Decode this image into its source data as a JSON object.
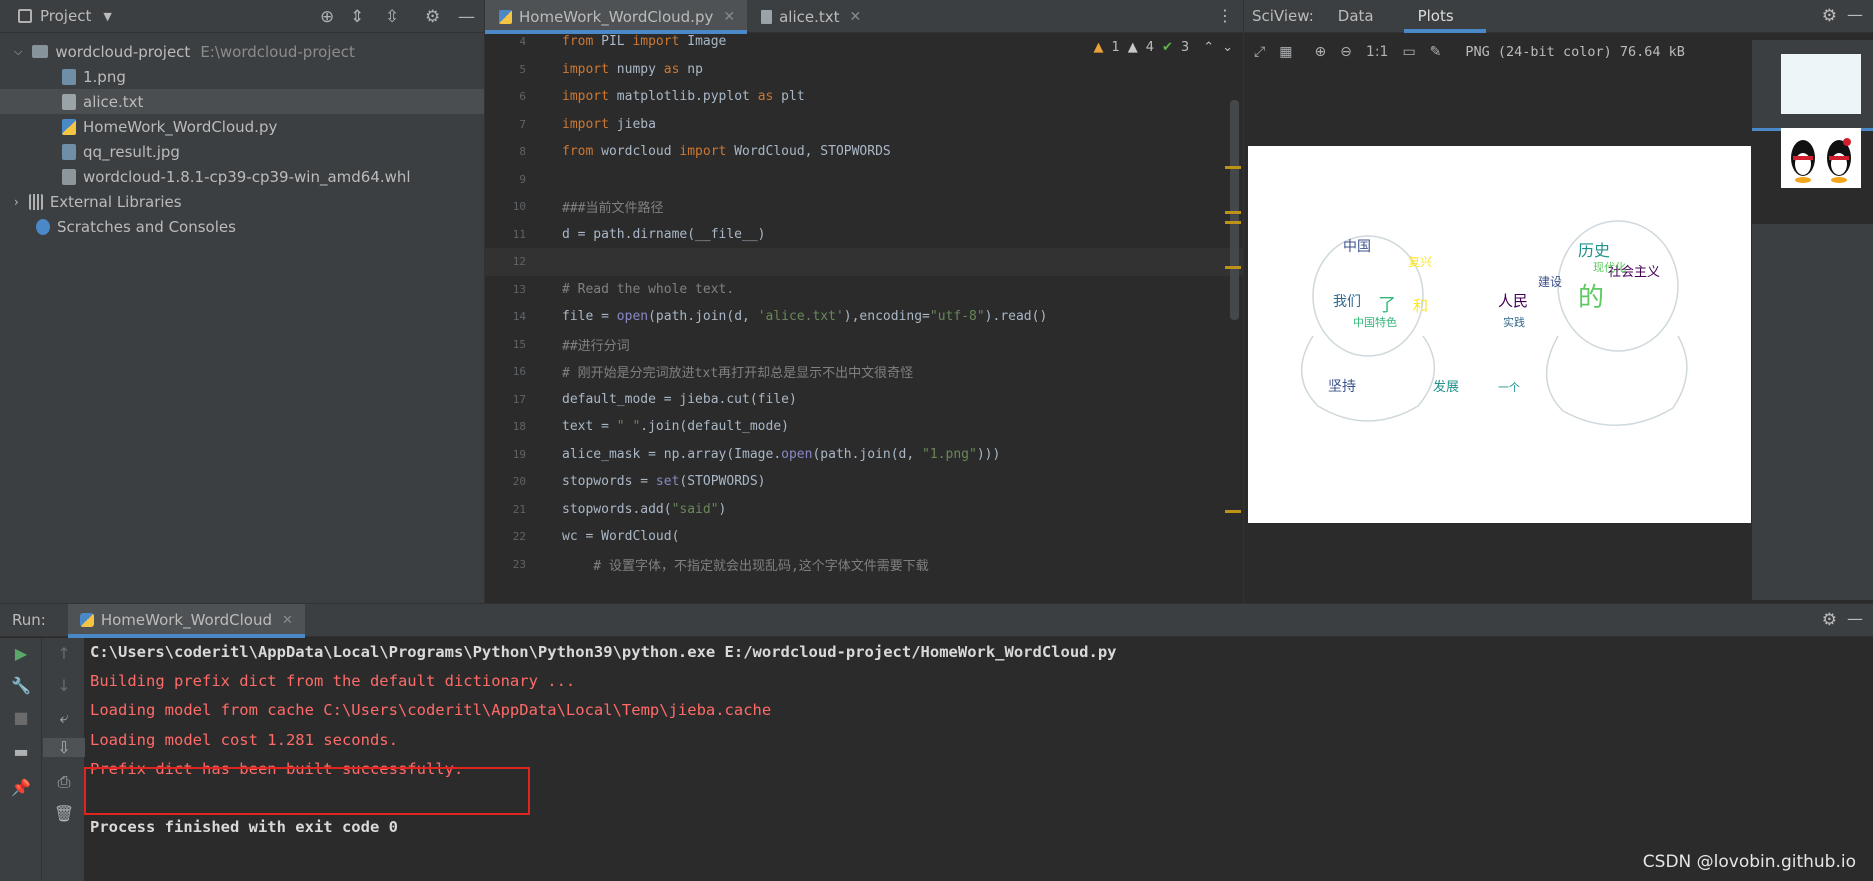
{
  "project": {
    "title": "Project",
    "tree": [
      {
        "label": "wordcloud-project",
        "path": "E:\\wordcloud-project",
        "type": "folder"
      },
      {
        "label": "1.png",
        "type": "png"
      },
      {
        "label": "alice.txt",
        "type": "txt"
      },
      {
        "label": "HomeWork_WordCloud.py",
        "type": "py"
      },
      {
        "label": "qq_result.jpg",
        "type": "jpg"
      },
      {
        "label": "wordcloud-1.8.1-cp39-cp39-win_amd64.whl",
        "type": "whl"
      },
      {
        "label": "External Libraries",
        "type": "lib"
      },
      {
        "label": "Scratches and Consoles",
        "type": "scratch"
      }
    ]
  },
  "editor": {
    "tabs": [
      {
        "label": "HomeWork_WordCloud.py",
        "active": true
      },
      {
        "label": "alice.txt",
        "active": false
      }
    ],
    "inspections": {
      "errors": "1",
      "warnings": "4",
      "ok": "3"
    },
    "lines": [
      {
        "n": "4",
        "code": "from PIL import Image"
      },
      {
        "n": "5",
        "code": "import numpy as np"
      },
      {
        "n": "6",
        "code": "import matplotlib.pyplot as plt"
      },
      {
        "n": "7",
        "code": "import jieba"
      },
      {
        "n": "8",
        "code": "from wordcloud import WordCloud, STOPWORDS"
      },
      {
        "n": "9",
        "code": ""
      },
      {
        "n": "10",
        "code": "###当前文件路径"
      },
      {
        "n": "11",
        "code": "d = path.dirname(__file__)"
      },
      {
        "n": "12",
        "code": ""
      },
      {
        "n": "13",
        "code": "# Read the whole text."
      },
      {
        "n": "14",
        "code": "file = open(path.join(d, 'alice.txt'),encoding=\"utf-8\").read()"
      },
      {
        "n": "15",
        "code": "##进行分词"
      },
      {
        "n": "16",
        "code": "# 刚开始是分完词放进txt再打开却总是显示不出中文很奇怪"
      },
      {
        "n": "17",
        "code": "default_mode = jieba.cut(file)"
      },
      {
        "n": "18",
        "code": "text = \" \".join(default_mode)"
      },
      {
        "n": "19",
        "code": "alice_mask = np.array(Image.open(path.join(d, \"1.png\")))"
      },
      {
        "n": "20",
        "code": "stopwords = set(STOPWORDS)"
      },
      {
        "n": "21",
        "code": "stopwords.add(\"said\")"
      },
      {
        "n": "22",
        "code": "wc = WordCloud("
      },
      {
        "n": "23",
        "code": "    # 设置字体，不指定就会出现乱码,这个字体文件需要下载"
      }
    ]
  },
  "sciview": {
    "title": "SciView:",
    "tabs": [
      "Data",
      "Plots"
    ],
    "active_tab": "Plots",
    "zoom_label": "1:1",
    "image_info": "PNG (24-bit color) 76.64 kB",
    "wordcloud_words": [
      "中国",
      "历史",
      "人民",
      "的",
      "我们",
      "了",
      "和",
      "坚持",
      "发展",
      "社会主义",
      "现代化",
      "实践",
      "中国特色",
      "复兴",
      "建设",
      "一个"
    ]
  },
  "run": {
    "label": "Run:",
    "tab": "HomeWork_WordCloud",
    "output": [
      {
        "text": "C:\\Users\\coderitl\\AppData\\Local\\Programs\\Python\\Python39\\python.exe E:/wordcloud-project/HomeWork_WordCloud.py",
        "kind": "norm"
      },
      {
        "text": "Building prefix dict from the default dictionary ...",
        "kind": "err"
      },
      {
        "text": "Loading model from cache C:\\Users\\coderitl\\AppData\\Local\\Temp\\jieba.cache",
        "kind": "err"
      },
      {
        "text": "Loading model cost 1.281 seconds.",
        "kind": "err"
      },
      {
        "text": "Prefix dict has been built successfully.",
        "kind": "err"
      },
      {
        "text": "",
        "kind": "norm"
      },
      {
        "text": "Process finished with exit code 0",
        "kind": "norm"
      }
    ]
  },
  "watermark": "CSDN @lovobin.github.io"
}
